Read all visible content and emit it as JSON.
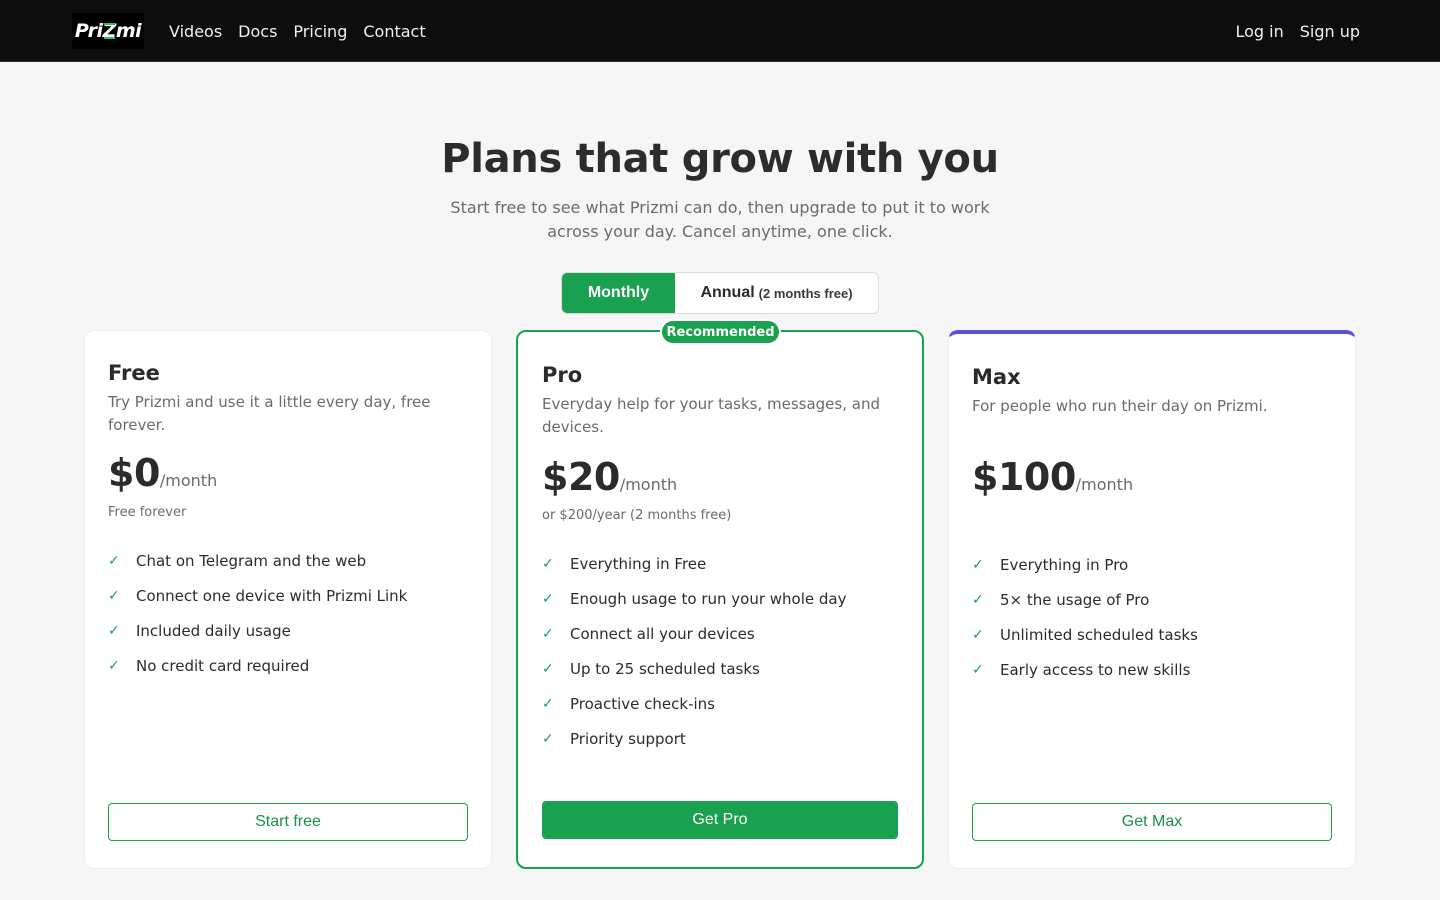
{
  "nav": {
    "logo": {
      "part1": "Pri",
      "z": "Z",
      "part2": "mi"
    },
    "links": [
      "Videos",
      "Docs",
      "Pricing",
      "Contact"
    ],
    "login": "Log in",
    "signup": "Sign up"
  },
  "hero": {
    "title": "Plans that grow with you",
    "subtitle": "Start free to see what Prizmi can do, then upgrade to put it to work across your day. Cancel anytime, one click."
  },
  "billing": {
    "monthly": "Monthly",
    "annual": "Annual",
    "annual_note": "(2 months free)",
    "selected": "Monthly"
  },
  "plans": {
    "free": {
      "name": "Free",
      "description": "Try Prizmi and use it a little every day, free forever.",
      "price": "$0",
      "period": "/month",
      "note": "Free forever",
      "features": [
        "Chat on Telegram and the web",
        "Connect one device with Prizmi Link",
        "Included daily usage",
        "No credit card required"
      ],
      "cta": "Start free"
    },
    "pro": {
      "badge": "Recommended",
      "name": "Pro",
      "description": "Everyday help for your tasks, messages, and devices.",
      "price": "$20",
      "period": "/month",
      "note": "or $200/year (2 months free)",
      "features": [
        "Everything in Free",
        "Enough usage to run your whole day",
        "Connect all your devices",
        "Up to 25 scheduled tasks",
        "Proactive check-ins",
        "Priority support"
      ],
      "cta": "Get Pro"
    },
    "max": {
      "name": "Max",
      "description": "For people who run their day on Prizmi.",
      "price": "$100",
      "period": "/month",
      "features": [
        "Everything in Pro",
        "5× the usage of Pro",
        "Unlimited scheduled tasks",
        "Early access to new skills"
      ],
      "cta": "Get Max"
    }
  },
  "colors": {
    "accent": "#1aa14f",
    "max_accent": "#5b4fd8",
    "nav_bg": "#0d0d0d"
  },
  "check_icon": "✓"
}
